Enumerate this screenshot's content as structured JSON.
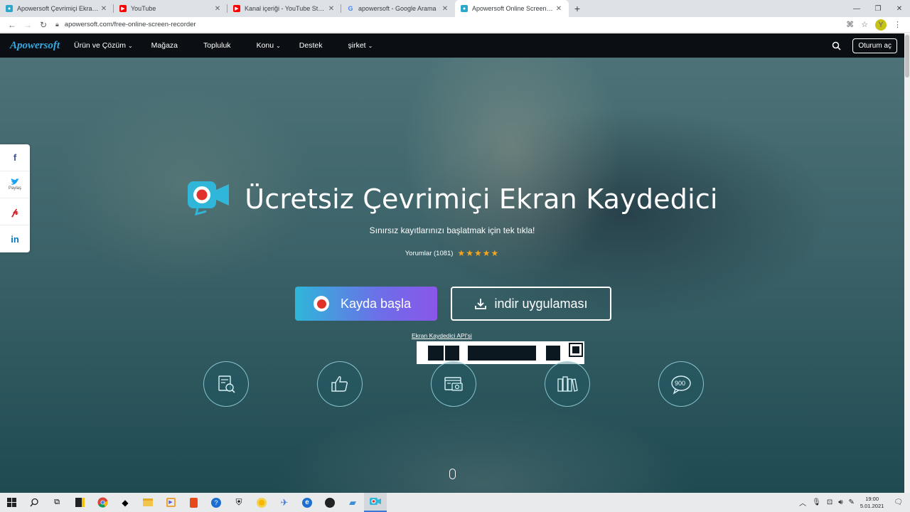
{
  "browser": {
    "tabs": [
      {
        "title": "Apowersoft Çevrimiçi Ekran Kayde",
        "favicon": "apowersoft-icon",
        "color": "#2aa7c9"
      },
      {
        "title": "YouTube",
        "favicon": "youtube-icon",
        "color": "#ff0000"
      },
      {
        "title": "Kanal içeriği - YouTube Studio",
        "favicon": "youtube-studio-icon",
        "color": "#ff0000"
      },
      {
        "title": "apowersoft - Google Arama",
        "favicon": "google-icon",
        "color": "#4285f4"
      },
      {
        "title": "Apowersoft Online Screen Recor",
        "favicon": "apowersoft-icon",
        "color": "#2aa7c9",
        "active": true
      }
    ],
    "url": "apowersoft.com/free-online-screen-recorder",
    "avatar_letter": "Y"
  },
  "site": {
    "logo": "Apowersoft",
    "nav": [
      {
        "label": "Ürün ve Çözüm",
        "dropdown": true
      },
      {
        "label": "Mağaza",
        "dropdown": false
      },
      {
        "label": "Topluluk",
        "dropdown": false
      },
      {
        "label": "Konu",
        "dropdown": true
      },
      {
        "label": "Destek",
        "dropdown": false
      },
      {
        "label": "şirket",
        "dropdown": true
      }
    ],
    "login_label": "Oturum aç"
  },
  "social": {
    "share_label": "Paylaş",
    "items": [
      "f",
      "t",
      "p",
      "in"
    ]
  },
  "hero": {
    "title": "Ücretsiz Çevrimiçi Ekran Kaydedici",
    "subtitle": "Sınırsız kayıtlarınızı başlatmak için tek tıkla!",
    "reviews": "Yorumlar (1081)",
    "rating_stars": 5,
    "record_button": "Kayda başla",
    "download_button": "indir uygulaması",
    "api_link": "Ekran Kaydedici API'si",
    "features": [
      {
        "icon": "document-search-icon"
      },
      {
        "icon": "thumbs-up-icon"
      },
      {
        "icon": "screen-camera-icon"
      },
      {
        "icon": "books-icon"
      },
      {
        "icon": "chat-bubble-icon",
        "label": "900"
      }
    ]
  },
  "taskbar": {
    "time": "19:00",
    "date": "5.01.2021"
  },
  "colors": {
    "accent": "#2fb6d9",
    "record_gradient_end": "#8a56ea",
    "nav_bg": "#0b0f13",
    "stars": "#f5a623"
  }
}
